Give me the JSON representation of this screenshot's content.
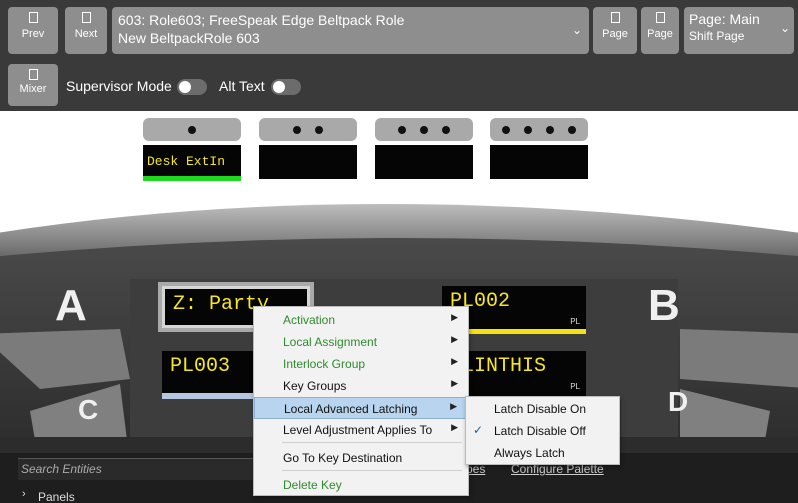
{
  "toolbar": {
    "prev_label": "Prev",
    "next_label": "Next",
    "role_line1": "603: Role603; FreeSpeak Edge Beltpack Role",
    "role_line2": "New BeltpackRole 603",
    "page_prev_label": "Page",
    "page_next_label": "Page",
    "page_line1": "Page: Main",
    "page_line2": "Shift Page",
    "mixer_label": "Mixer",
    "supervisor_label": "Supervisor Mode",
    "alttext_label": "Alt Text"
  },
  "panel": {
    "top_displays": [
      {
        "text": "Desk ExtIn",
        "dots": 1
      },
      {
        "text": "",
        "dots": 2
      },
      {
        "text": "",
        "dots": 3
      },
      {
        "text": "",
        "dots": 4
      }
    ],
    "hw_keys": {
      "a": "A",
      "b": "B",
      "c": "C",
      "d": "D"
    },
    "key_slots": {
      "top_left": "Z: Party",
      "top_right": "PL002",
      "top_right_tag": "PL",
      "bottom_left": "PL003",
      "bottom_right": "NLINTHIS",
      "bottom_right_tag": "PL"
    }
  },
  "bottom": {
    "search_placeholder": "Search Entities",
    "panels_label": "Panels",
    "types_link": "pes",
    "configure_palette_link": "Configure Palette"
  },
  "context_menu": {
    "items": [
      {
        "label": "Activation",
        "submenu": true
      },
      {
        "label": "Local Assignment",
        "submenu": true
      },
      {
        "label": "Interlock Group",
        "submenu": true
      },
      {
        "label": "Key Groups",
        "submenu": true
      },
      {
        "label": "Local Advanced Latching",
        "submenu": true,
        "selected": true
      },
      {
        "label": "Level Adjustment Applies To",
        "submenu": true
      },
      {
        "label": "Go To Key Destination",
        "submenu": false
      },
      {
        "label": "Delete Key",
        "submenu": false
      }
    ],
    "submenu": [
      {
        "label": "Latch Disable On",
        "checked": false
      },
      {
        "label": "Latch Disable Off",
        "checked": true
      },
      {
        "label": "Always Latch",
        "checked": false
      }
    ]
  },
  "colors": {
    "accent_green": "#2e8b2e",
    "display_text": "#f7e81a",
    "toolbar_bg": "#3a3a3a"
  }
}
